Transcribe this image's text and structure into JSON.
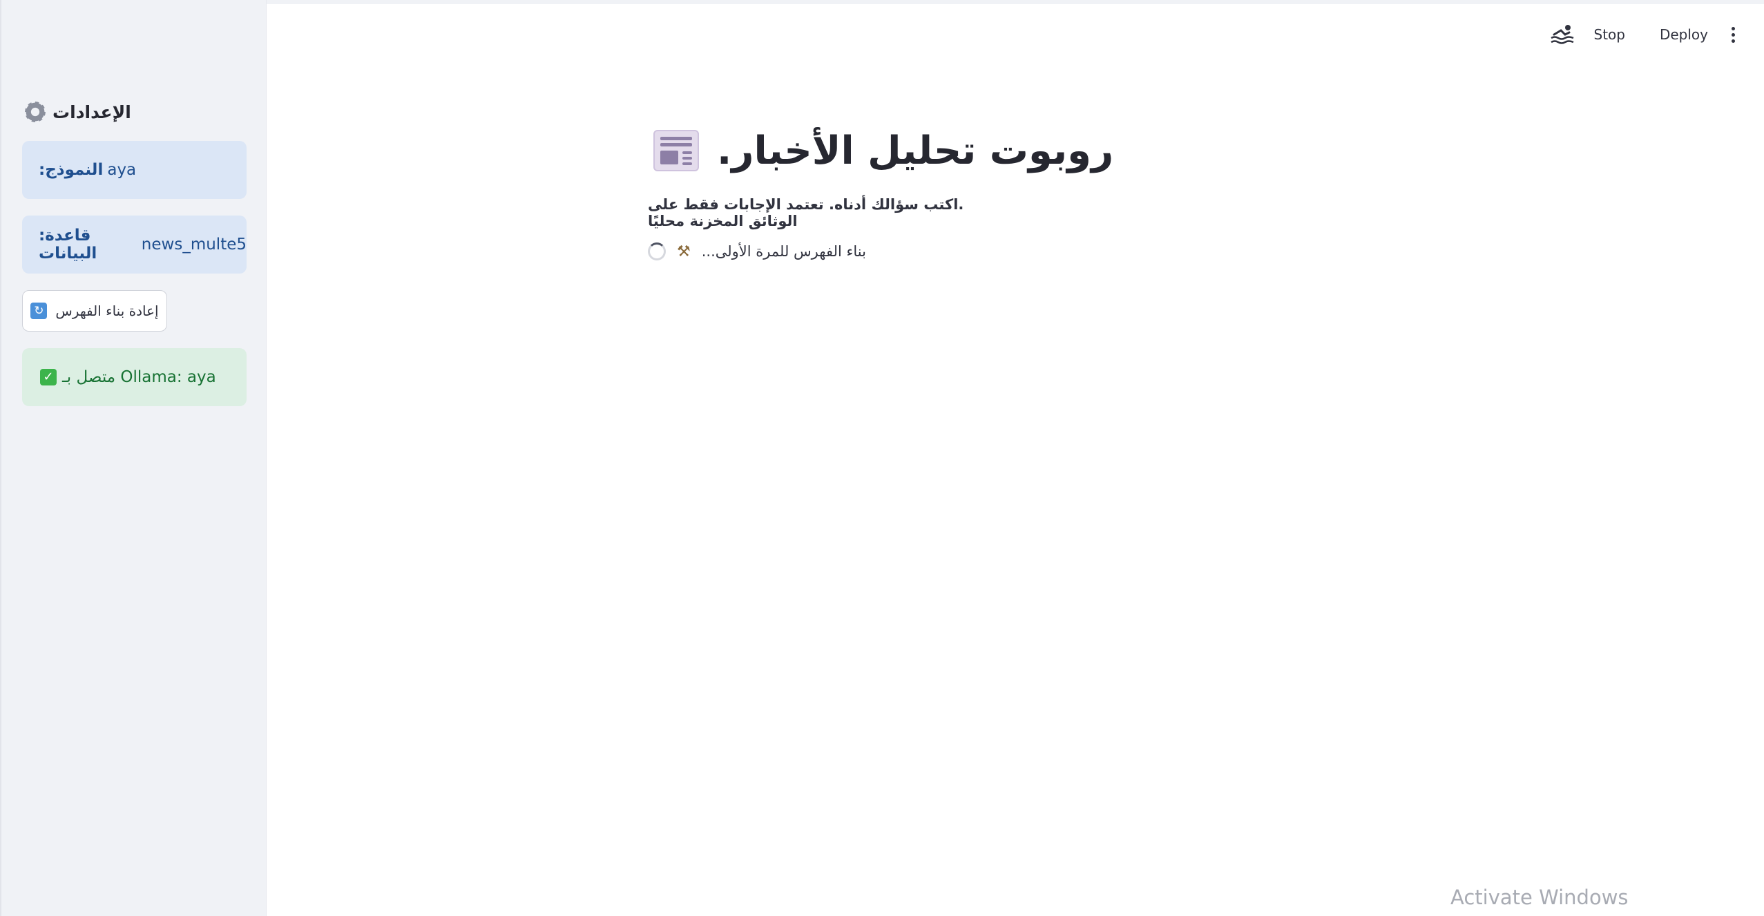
{
  "sidebar": {
    "header": "الإعدادات",
    "model_label": ":النموذج",
    "model_value": "aya",
    "db_label": ":قاعدة البيانات",
    "db_value": "news_multe5",
    "rebuild_label": "إعادة بناء الفهرس",
    "status_text": "متصل بـ Ollama: aya"
  },
  "toolbar": {
    "stop_label": "Stop",
    "deploy_label": "Deploy"
  },
  "main": {
    "title": "روبوت تحليل الأخبار.",
    "subtitle": ".اكتب سؤالك أدناه. تعتمد الإجابات فقط على الوثائق المخزنة محليًا",
    "spinner_text": "...بناء الفهرس للمرة الأولى"
  },
  "watermark": "Activate Windows",
  "colors": {
    "sidebar_bg": "#f0f2f6",
    "info_bg": "#dbe6f6",
    "success_bg": "#dcefe3",
    "success_text": "#177233",
    "info_text": "#1f4f8f"
  },
  "icons": [
    "gear-icon",
    "refresh-icon",
    "check-icon",
    "swimmer-icon",
    "kebab-menu-icon",
    "newspaper-icon",
    "hammer-icon",
    "spinner-icon"
  ]
}
